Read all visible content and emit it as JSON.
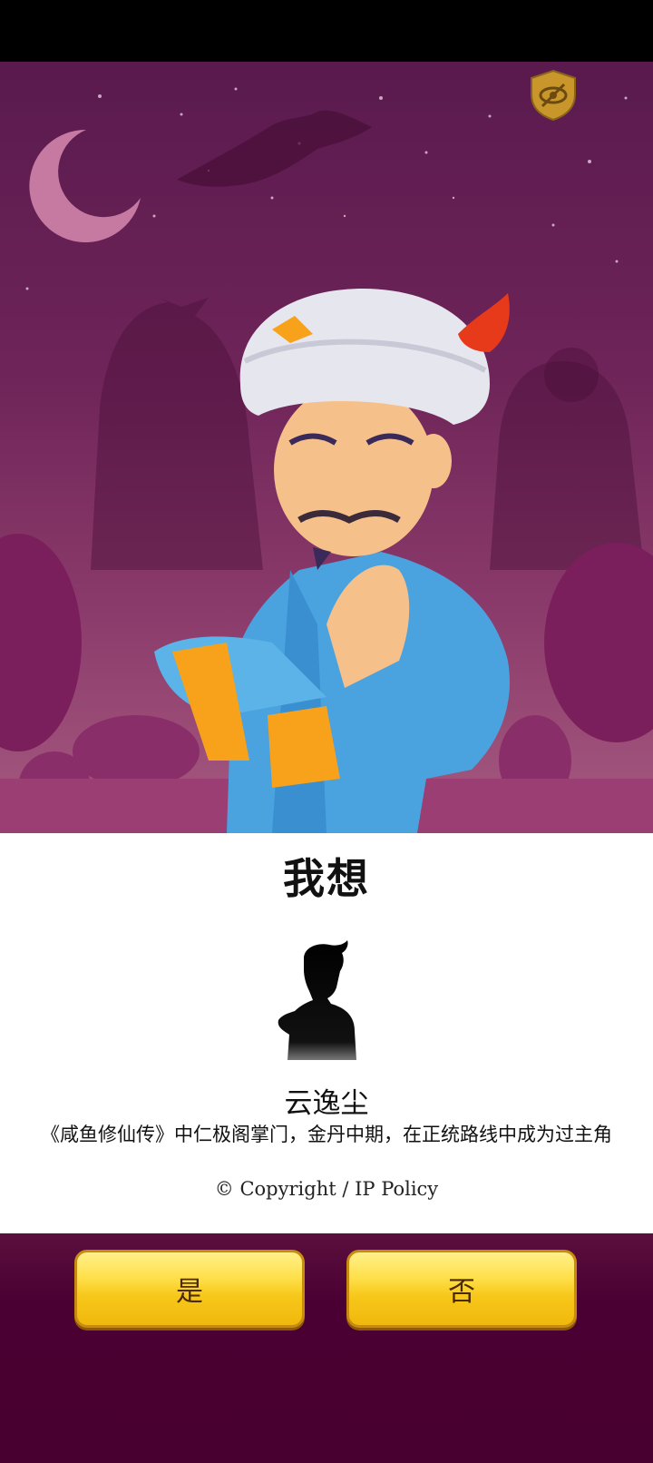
{
  "question": "我想",
  "character": {
    "name": "云逸尘",
    "description": "《咸鱼修仙传》中仁极阁掌门，金丹中期，在正统路线中成为过主角"
  },
  "footer": {
    "copyright": "© Copyright",
    "separator": " / ",
    "policy": "IP Policy"
  },
  "buttons": {
    "yes": "是",
    "no": "否"
  },
  "icons": {
    "privacy": "eye-slash-shield-icon",
    "silhouette": "character-silhouette-icon"
  },
  "colors": {
    "background_top": "#5a1a4e",
    "bottom_panel": "#4a0032",
    "button_gold": "#f7c71a",
    "badge_gold": "#c9962b"
  }
}
